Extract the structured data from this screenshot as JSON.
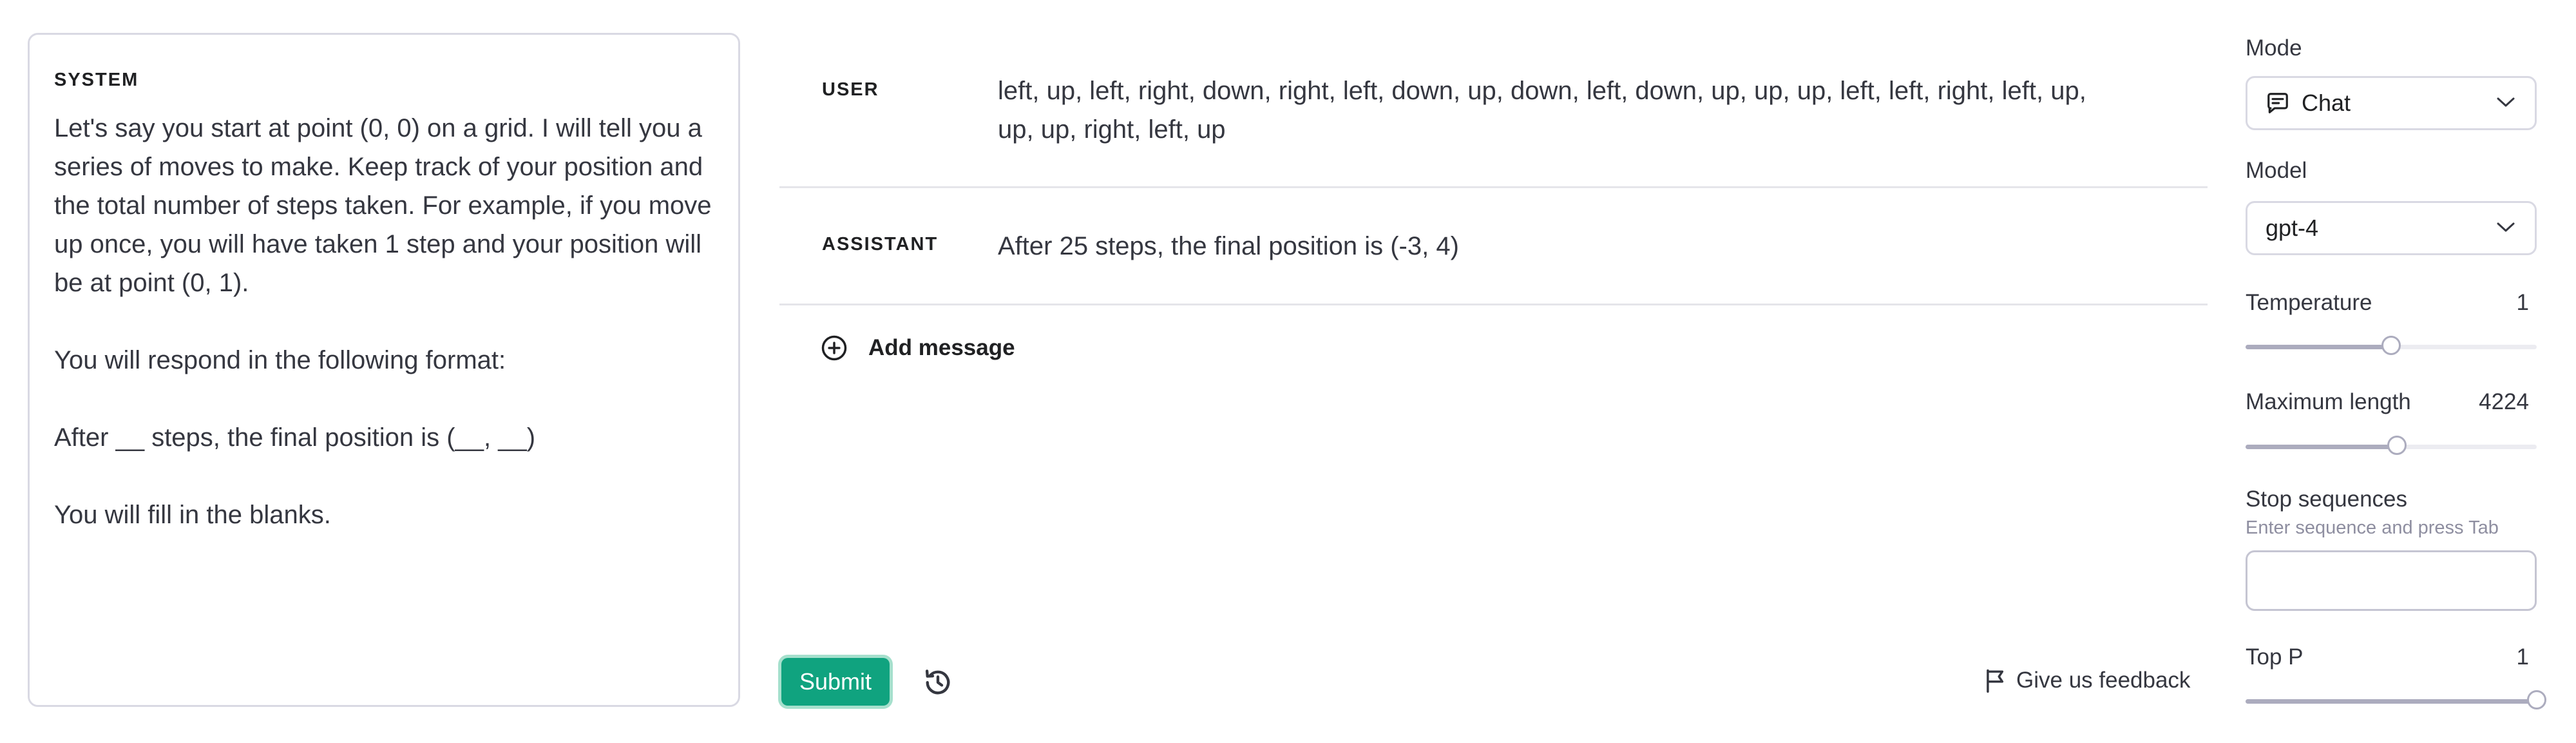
{
  "system": {
    "heading": "SYSTEM",
    "paragraphs": [
      "Let's say you start at point (0, 0) on a grid. I will tell you a series of moves to make. Keep track of your position and the total number of steps taken. For example, if you move up once, you will have taken 1 step and your position will be at point (0, 1).",
      "You will respond in the following format:",
      "After __ steps, the final position is (__, __)",
      "You will fill in the blanks."
    ]
  },
  "messages": [
    {
      "role": "USER",
      "text": "left, up, left, right, down, right, left, down, up, down, left, down, up, up, up, left, left, right, left, up, up, up, right, left, up"
    },
    {
      "role": "ASSISTANT",
      "text": "After 25 steps, the final position is (-3, 4)"
    }
  ],
  "add_message_label": "Add message",
  "footer": {
    "submit_label": "Submit",
    "feedback_label": "Give us feedback"
  },
  "sidebar": {
    "mode": {
      "label": "Mode",
      "value": "Chat",
      "icon": "chat-bubble-icon"
    },
    "model": {
      "label": "Model",
      "value": "gpt-4"
    },
    "temperature": {
      "label": "Temperature",
      "value": "1",
      "fraction": 0.5
    },
    "max_length": {
      "label": "Maximum length",
      "value": "4224",
      "fraction": 0.52
    },
    "stop_sequences": {
      "label": "Stop sequences",
      "hint": "Enter sequence and press Tab",
      "value": ""
    },
    "top_p": {
      "label": "Top P",
      "value": "1",
      "fraction": 1.0
    }
  },
  "colors": {
    "accent": "#10a37f",
    "text": "#353740",
    "border": "#d9d9e3"
  }
}
